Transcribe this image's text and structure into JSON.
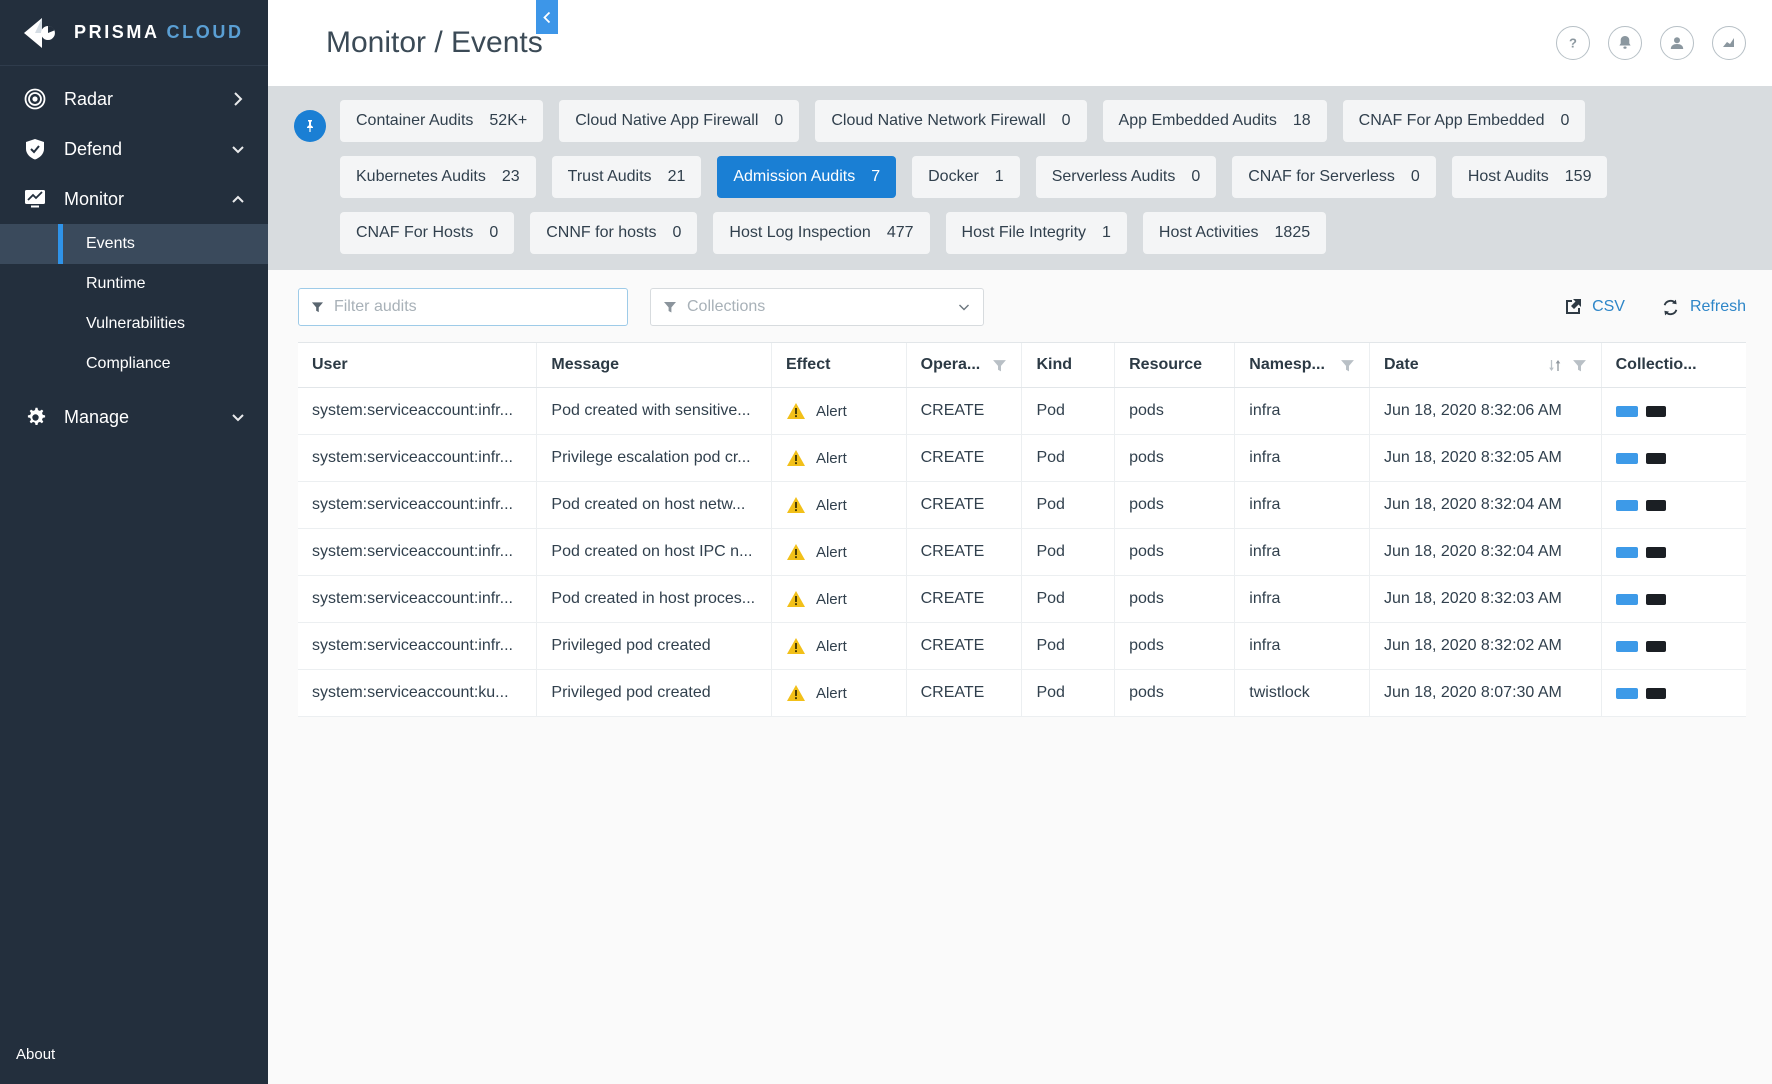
{
  "brand": {
    "name_primary": "PRISMA",
    "name_secondary": "CLOUD"
  },
  "sidebar": {
    "items": [
      {
        "label": "Radar",
        "icon": "radar-icon",
        "chevron": "chevron-right"
      },
      {
        "label": "Defend",
        "icon": "shield-icon",
        "chevron": "chevron-down"
      },
      {
        "label": "Monitor",
        "icon": "monitor-icon",
        "chevron": "chevron-up"
      },
      {
        "label": "Manage",
        "icon": "gear-icon",
        "chevron": "chevron-down"
      }
    ],
    "monitor_children": [
      {
        "label": "Events",
        "active": true
      },
      {
        "label": "Runtime",
        "active": false
      },
      {
        "label": "Vulnerabilities",
        "active": false
      },
      {
        "label": "Compliance",
        "active": false
      }
    ],
    "about_label": "About",
    "collapse_icon": "chevron-left-icon",
    "active_color": "#2f93e8"
  },
  "header": {
    "title": "Monitor / Events",
    "icons": [
      {
        "name": "help-icon",
        "glyph": "?"
      },
      {
        "name": "notifications-icon",
        "glyph": "bell"
      },
      {
        "name": "user-account-icon",
        "glyph": "user"
      },
      {
        "name": "analytics-icon",
        "glyph": "chart"
      }
    ]
  },
  "tabs": {
    "pin_icon": "pin-icon",
    "items": [
      {
        "label": "Container Audits",
        "count": "52K+",
        "selected": false
      },
      {
        "label": "Cloud Native App Firewall",
        "count": "0",
        "selected": false
      },
      {
        "label": "Cloud Native Network Firewall",
        "count": "0",
        "selected": false
      },
      {
        "label": "App Embedded Audits",
        "count": "18",
        "selected": false
      },
      {
        "label": "CNAF For App Embedded",
        "count": "0",
        "selected": false
      },
      {
        "label": "Kubernetes Audits",
        "count": "23",
        "selected": false
      },
      {
        "label": "Trust Audits",
        "count": "21",
        "selected": false
      },
      {
        "label": "Admission Audits",
        "count": "7",
        "selected": true
      },
      {
        "label": "Docker",
        "count": "1",
        "selected": false
      },
      {
        "label": "Serverless Audits",
        "count": "0",
        "selected": false
      },
      {
        "label": "CNAF for Serverless",
        "count": "0",
        "selected": false
      },
      {
        "label": "Host Audits",
        "count": "159",
        "selected": false
      },
      {
        "label": "CNAF For Hosts",
        "count": "0",
        "selected": false
      },
      {
        "label": "CNNF for hosts",
        "count": "0",
        "selected": false
      },
      {
        "label": "Host Log Inspection",
        "count": "477",
        "selected": false
      },
      {
        "label": "Host File Integrity",
        "count": "1",
        "selected": false
      },
      {
        "label": "Host Activities",
        "count": "1825",
        "selected": false
      }
    ],
    "selected_color": "#1a7fd4"
  },
  "toolbar": {
    "filter_placeholder": "Filter audits",
    "filter_value": "",
    "collections_placeholder": "Collections",
    "csv_label": "CSV",
    "refresh_label": "Refresh",
    "link_color": "#2e86c8"
  },
  "table": {
    "columns": [
      {
        "label": "User",
        "filter": false,
        "sort": false
      },
      {
        "label": "Message",
        "filter": false,
        "sort": false
      },
      {
        "label": "Effect",
        "filter": false,
        "sort": false
      },
      {
        "label": "Opera...",
        "filter": true,
        "sort": false
      },
      {
        "label": "Kind",
        "filter": false,
        "sort": false
      },
      {
        "label": "Resource",
        "filter": false,
        "sort": false
      },
      {
        "label": "Namesp...",
        "filter": true,
        "sort": false
      },
      {
        "label": "Date",
        "filter": true,
        "sort": true
      },
      {
        "label": "Collectio...",
        "filter": false,
        "sort": false
      }
    ],
    "rows": [
      {
        "user": "system:serviceaccount:infr...",
        "message": "Pod created with sensitive...",
        "effect": "Alert",
        "operation": "CREATE",
        "kind": "Pod",
        "resource": "pods",
        "namespace": "infra",
        "date": "Jun 18, 2020 8:32:06 AM"
      },
      {
        "user": "system:serviceaccount:infr...",
        "message": "Privilege escalation pod cr...",
        "effect": "Alert",
        "operation": "CREATE",
        "kind": "Pod",
        "resource": "pods",
        "namespace": "infra",
        "date": "Jun 18, 2020 8:32:05 AM"
      },
      {
        "user": "system:serviceaccount:infr...",
        "message": "Pod created on host netw...",
        "effect": "Alert",
        "operation": "CREATE",
        "kind": "Pod",
        "resource": "pods",
        "namespace": "infra",
        "date": "Jun 18, 2020 8:32:04 AM"
      },
      {
        "user": "system:serviceaccount:infr...",
        "message": "Pod created on host IPC n...",
        "effect": "Alert",
        "operation": "CREATE",
        "kind": "Pod",
        "resource": "pods",
        "namespace": "infra",
        "date": "Jun 18, 2020 8:32:04 AM"
      },
      {
        "user": "system:serviceaccount:infr...",
        "message": "Pod created in host proces...",
        "effect": "Alert",
        "operation": "CREATE",
        "kind": "Pod",
        "resource": "pods",
        "namespace": "infra",
        "date": "Jun 18, 2020 8:32:03 AM"
      },
      {
        "user": "system:serviceaccount:infr...",
        "message": "Privileged pod created",
        "effect": "Alert",
        "operation": "CREATE",
        "kind": "Pod",
        "resource": "pods",
        "namespace": "infra",
        "date": "Jun 18, 2020 8:32:02 AM"
      },
      {
        "user": "system:serviceaccount:ku...",
        "message": "Privileged pod created",
        "effect": "Alert",
        "operation": "CREATE",
        "kind": "Pod",
        "resource": "pods",
        "namespace": "twistlock",
        "date": "Jun 18, 2020 8:07:30 AM"
      }
    ],
    "collection_chip_colors": [
      "#3d9ae8",
      "#1b1f24"
    ],
    "alert_icon_color": "#f2c019"
  }
}
